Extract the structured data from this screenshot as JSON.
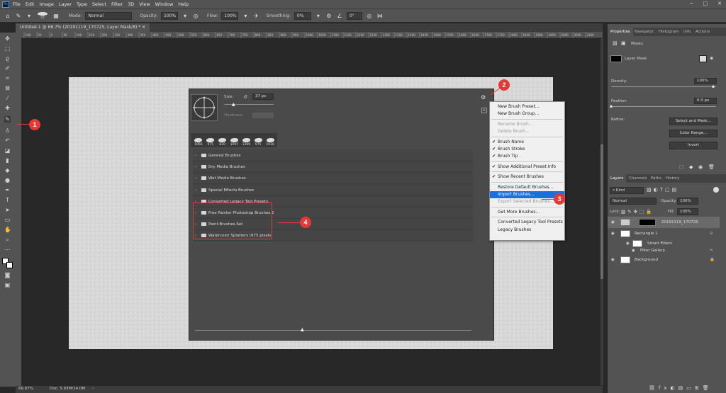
{
  "menu": {
    "items": [
      "File",
      "Edit",
      "Image",
      "Layer",
      "Type",
      "Select",
      "Filter",
      "3D",
      "View",
      "Window",
      "Help"
    ]
  },
  "options": {
    "brush_size": "37",
    "mode_label": "Mode:",
    "mode_value": "Normal",
    "opacity_label": "Opacity:",
    "opacity_value": "100%",
    "flow_label": "Flow:",
    "flow_value": "100%",
    "smoothing_label": "Smoothing:",
    "smoothing_value": "0%",
    "angle_value": "0°"
  },
  "document": {
    "tab_title": "Untitled-1 @ 66.7% (20191119_170725, Layer Mask/8) *",
    "zoom": "66.67%",
    "doc_size": "Doc: 5.93M/14.0M"
  },
  "ruler": {
    "h_ticks": [
      "100",
      "50",
      "0",
      "50",
      "100",
      "150",
      "200",
      "250",
      "300",
      "350",
      "400",
      "450",
      "500",
      "550",
      "600",
      "650",
      "700",
      "750",
      "800",
      "850",
      "900",
      "950",
      "1000",
      "1050",
      "1100",
      "1150",
      "1200",
      "1250",
      "1300",
      "1350",
      "1400",
      "1450",
      "1500",
      "1550",
      "1600",
      "1650",
      "1700",
      "1750",
      "1800",
      "1850",
      "1900",
      "1950",
      "2000",
      "2050",
      "2100"
    ]
  },
  "brush_picker": {
    "size_label": "Size:",
    "size_value": "37 px",
    "hardness_label": "Hardness:",
    "preset_sizes": [
      "1066",
      "975",
      "820",
      "1007",
      "1369",
      "975",
      "1016"
    ],
    "folders": [
      "General Brushes",
      "Dry Media Brushes",
      "Wet Media Brushes",
      "Special Effects Brushes",
      "Converted Legacy Tool Presets",
      "Free Painter Photoshop Brushes 2",
      "Paint-Brushes-Set",
      "Watercolor Splatters (675 pixels)"
    ]
  },
  "dropdown": {
    "items": [
      {
        "label": "New Brush Preset...",
        "state": "normal"
      },
      {
        "label": "New Brush Group...",
        "state": "normal"
      },
      {
        "label": "Rename Brush...",
        "state": "disabled"
      },
      {
        "label": "Delete Brush...",
        "state": "disabled"
      },
      {
        "label": "Brush Name",
        "state": "checked"
      },
      {
        "label": "Brush Stroke",
        "state": "checked"
      },
      {
        "label": "Brush Tip",
        "state": "checked"
      },
      {
        "label": "Show Additional Preset Info",
        "state": "checked"
      },
      {
        "label": "Show Recent Brushes",
        "state": "checked"
      },
      {
        "label": "Restore Default Brushes...",
        "state": "normal"
      },
      {
        "label": "Import Brushes...",
        "state": "highlighted"
      },
      {
        "label": "Export Selected Brushes...",
        "state": "disabled"
      },
      {
        "label": "Get More Brushes...",
        "state": "normal"
      },
      {
        "label": "Converted Legacy Tool Presets",
        "state": "normal"
      },
      {
        "label": "Legacy Brushes",
        "state": "normal"
      }
    ]
  },
  "callouts": [
    "1",
    "2",
    "3",
    "4"
  ],
  "properties": {
    "tabs": [
      "Properties",
      "Navigator",
      "Histogram",
      "Info",
      "Actions"
    ],
    "masks_label": "Masks",
    "layer_mask_label": "Layer Mask",
    "density_label": "Density:",
    "density_value": "100%",
    "feather_label": "Feather:",
    "feather_value": "0.0 px",
    "refine_label": "Refine:",
    "btn_select_mask": "Select and Mask...",
    "btn_color_range": "Color Range...",
    "btn_invert": "Invert"
  },
  "layers": {
    "tabs": [
      "Layers",
      "Channels",
      "Paths",
      "History"
    ],
    "kind_label": "Kind",
    "blend_mode": "Normal",
    "opacity_label": "Opacity:",
    "opacity_value": "100%",
    "lock_label": "Lock:",
    "fill_label": "Fill:",
    "fill_value": "100%",
    "rows": [
      "20191119_170725",
      "Rectangle 1",
      "Smart Filters",
      "Filter Gallery",
      "Background"
    ]
  }
}
